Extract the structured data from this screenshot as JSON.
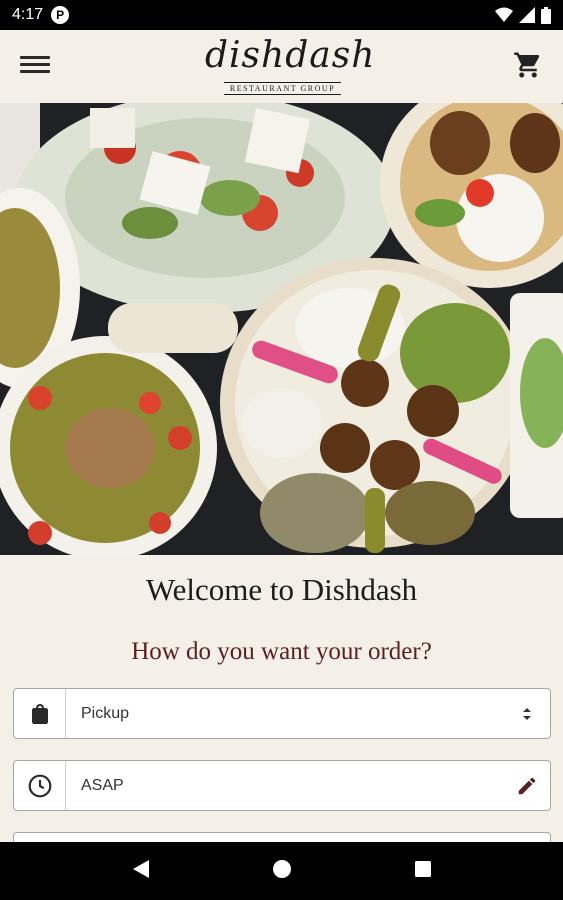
{
  "status_bar": {
    "time": "4:17",
    "notification_badge": "P",
    "icons": [
      "wifi-icon",
      "signal-icon",
      "battery-icon"
    ]
  },
  "app_bar": {
    "logo_text": "dishdash",
    "logo_subtext": "RESTAURANT GROUP",
    "icons": [
      "hamburger-menu-icon",
      "shopping-cart-icon"
    ]
  },
  "main": {
    "welcome_title": "Welcome to Dishdash",
    "order_question": "How do you want your order?",
    "order_type": {
      "value": "Pickup",
      "icon": "shopping-bag-icon",
      "trailing_icon": "select-arrows-icon"
    },
    "order_time": {
      "value": "ASAP",
      "icon": "clock-icon",
      "trailing_icon": "edit-pencil-icon"
    }
  },
  "colors": {
    "background": "#f4f0e8",
    "question_text": "#5a1f22",
    "title_text": "#1c1c1c",
    "field_border": "#a6a6a6"
  },
  "nav_bar": {
    "icons": [
      "back-icon",
      "home-icon",
      "recents-icon"
    ]
  }
}
